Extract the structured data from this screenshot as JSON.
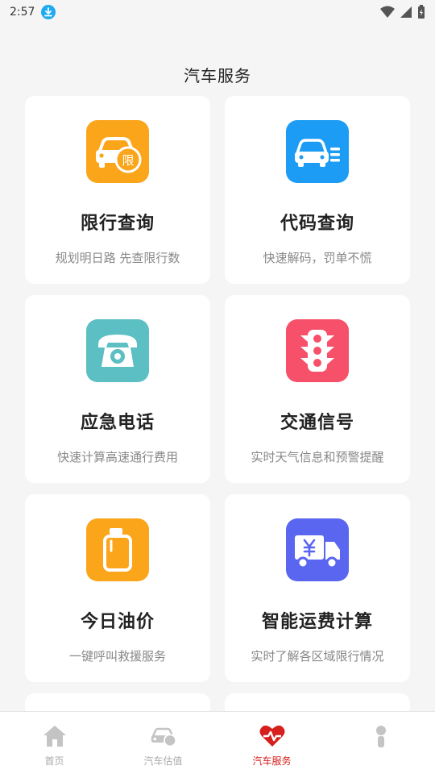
{
  "status_bar": {
    "time": "2:57"
  },
  "page": {
    "title": "汽车服务"
  },
  "services": [
    {
      "title": "限行查询",
      "subtitle": "规划明日路 先查限行数",
      "icon": "car-restriction-icon",
      "color": "#fba51b",
      "badge": "限"
    },
    {
      "title": "代码查询",
      "subtitle": "快速解码，罚单不慌",
      "icon": "car-code-icon",
      "color": "#1c9cf5"
    },
    {
      "title": "应急电话",
      "subtitle": "快速计算高速通行费用",
      "icon": "telephone-icon",
      "color": "#5bbfc3"
    },
    {
      "title": "交通信号",
      "subtitle": "实时天气信息和预警提醒",
      "icon": "traffic-light-icon",
      "color": "#f6506a"
    },
    {
      "title": "今日油价",
      "subtitle": "一键呼叫救援服务",
      "icon": "fuel-can-icon",
      "color": "#fba51b"
    },
    {
      "title": "智能运费计算",
      "subtitle": "实时了解各区域限行情况",
      "icon": "truck-yuan-icon",
      "color": "#5a66f0"
    }
  ],
  "tabbar": {
    "tabs": [
      {
        "label": "首页",
        "icon": "home-icon",
        "active": false
      },
      {
        "label": "汽车估值",
        "icon": "car-valuation-icon",
        "active": false
      },
      {
        "label": "汽车服务",
        "icon": "heart-service-icon",
        "active": true
      },
      {
        "label": "",
        "icon": "profile-icon",
        "active": false
      }
    ]
  },
  "colors": {
    "active_tab": "#d6201e",
    "inactive_tab": "#bbbbbb",
    "background": "#f5f5f5"
  }
}
